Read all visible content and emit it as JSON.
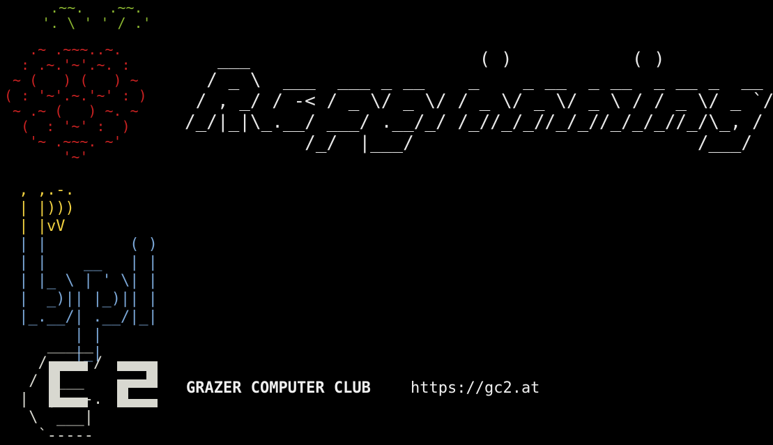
{
  "terminal": {
    "background": "#000000",
    "leaf_color": "#8ab530",
    "berry_color": "#cc2222",
    "title_color": "#e8e8e8",
    "bee_color": "#f0d040",
    "bpi_color": "#7aa6d6",
    "gc2_color": "#d8d8d0",
    "text_color": "#f0f0f0"
  },
  "raspberry_logo": {
    "leaves": "   .~~.   .~~.\n  '. \\ ' ' / .'",
    "berry": "   .~ .~~~..~.\n  : .~.'~'.~. :\n ~ (   ) (   ) ~\n( : '~'.~.'~' : )\n ~ .~ (   ) ~. ~\n  (  : '~' :  )\n   '~ .~~~. ~'\n       '~'"
  },
  "title_banner": {
    "text": "   ___                     ( )           ( )\n  / _ \\  ___  ___ _ __    _    _ __  _ __  _ __ _  __ _\n / , _/ / -< / _ \\/ _ \\/ / _ \\/ _ \\/ _ \\ / / _ \\/ _ `/\n/_/|_|\\_.__/ ___/ .__/_/ /_//_/_//_/_//_/_/_//_/\\_, /\n           /_/  |___/                          /___/"
  },
  "bpi_logo": {
    "bee": " , ,.-.\n | |)))\n | |vV",
    "letters": " | |         ( )\n | |    __   | |\n | |_ \\ | ' \\| |\n |  _)|| |_)|| |\n |_.__/| .__/|_|\n       | |\n       |_|"
  },
  "gc2_logo": {
    "art": "   _____\n  /     /\n /  ___\n|  |----.\n \\  ___|\n  `-----"
  },
  "footer": {
    "club_name": "GRAZER COMPUTER CLUB",
    "club_url": "https://gc2.at"
  }
}
